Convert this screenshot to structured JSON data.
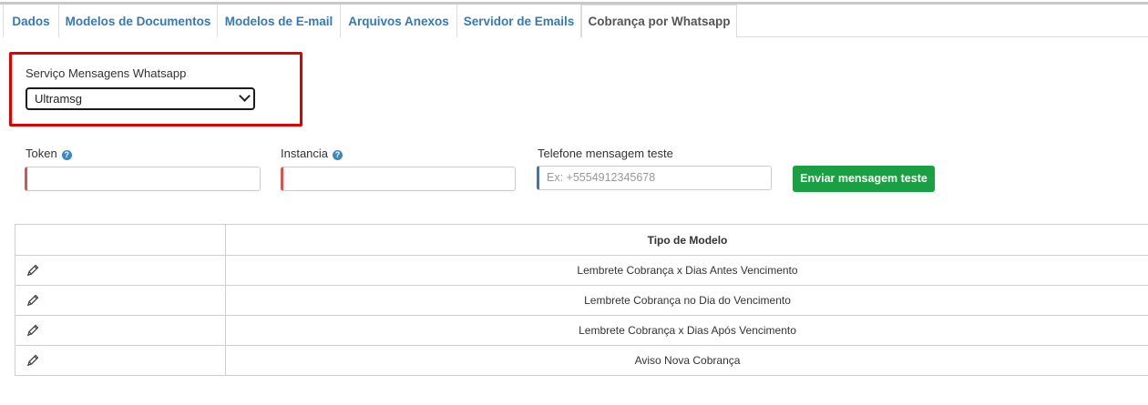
{
  "tabs": [
    {
      "label": "Dados"
    },
    {
      "label": "Modelos de Documentos"
    },
    {
      "label": "Modelos de E-mail"
    },
    {
      "label": "Arquivos Anexos"
    },
    {
      "label": "Servidor de Emails"
    },
    {
      "label": "Cobrança por Whatsapp",
      "active": true
    }
  ],
  "service": {
    "label": "Serviço Mensagens Whatsapp",
    "selected": "Ultramsg"
  },
  "fields": {
    "token_label": "Token",
    "instancia_label": "Instancia",
    "telefone_label": "Telefone mensagem teste",
    "telefone_placeholder": "Ex: +5554912345678",
    "token_value": "",
    "instancia_value": ""
  },
  "send_button": "Enviar mensagem teste",
  "table": {
    "header": "Tipo de Modelo",
    "rows": [
      "Lembrete Cobrança x Dias Antes Vencimento",
      "Lembrete Cobrança no Dia do Vencimento",
      "Lembrete Cobrança x Dias Após Vencimento",
      "Aviso Nova Cobrança"
    ]
  },
  "colors": {
    "tab_link": "#337ab7",
    "highlight": "#e00000",
    "button_green": "#1aa042",
    "required_border": "#d9534f"
  }
}
